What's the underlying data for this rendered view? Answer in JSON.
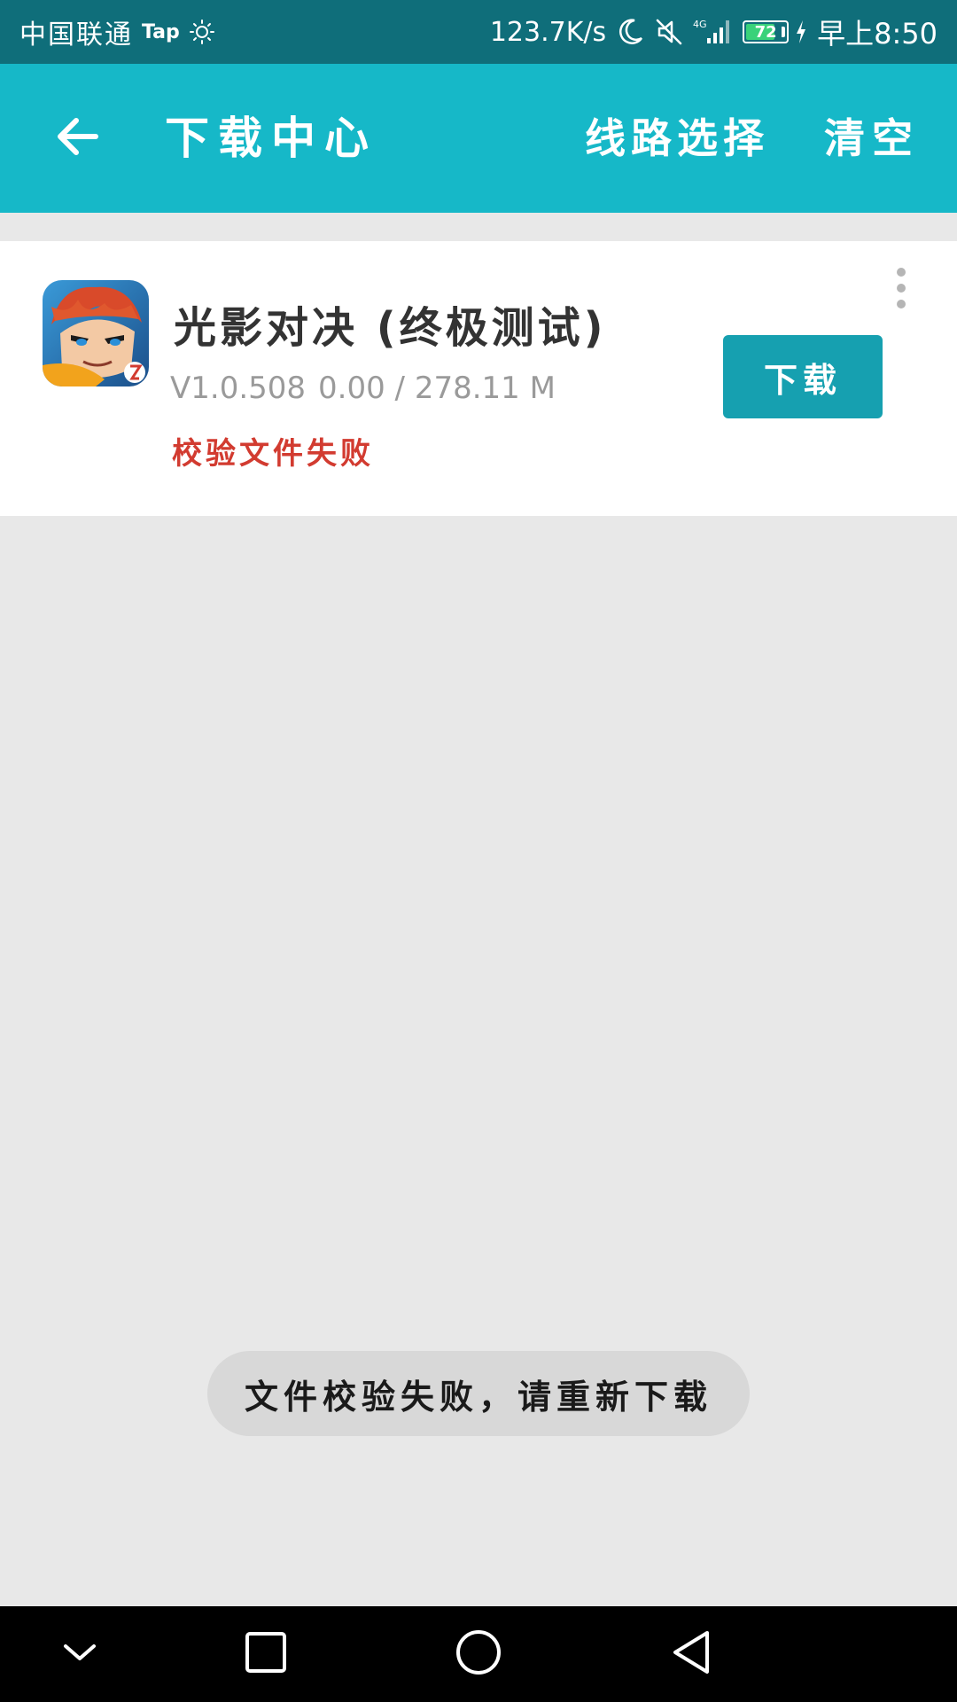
{
  "status_bar": {
    "carrier": "中国联通",
    "tap_label": "Tap",
    "net_speed": "123.7K/s",
    "network_type": "4G",
    "battery_level": "72",
    "time": "早上8:50",
    "icons": [
      "sun-icon",
      "moon-icon",
      "mute-icon",
      "signal-icon",
      "battery-icon",
      "charging-icon"
    ]
  },
  "app_bar": {
    "title": "下载中心",
    "route_label": "线路选择",
    "clear_label": "清空",
    "background": "#16b8c8"
  },
  "downloads": [
    {
      "title": "光影对决 (终极测试)",
      "version": "V1.0.508",
      "progress_text": "0.00 / 278.11 M",
      "error": "校验文件失败",
      "button_label": "下载",
      "progress": 0
    }
  ],
  "toast": {
    "message": "文件校验失败，请重新下载"
  },
  "colors": {
    "accent": "#16b8c8",
    "button": "#16a0b0",
    "error": "#d23b30",
    "status_bar": "#0f6e7a"
  }
}
